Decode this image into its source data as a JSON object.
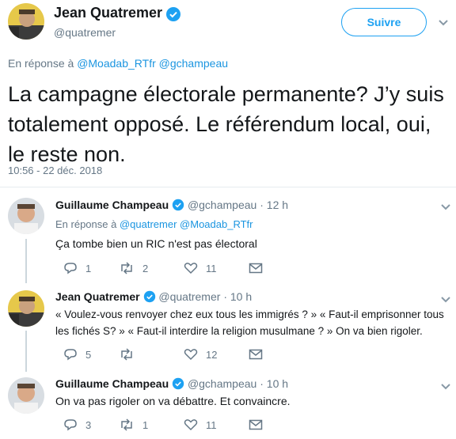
{
  "main_tweet": {
    "author_name": "Jean Quatremer",
    "handle": "@quatremer",
    "follow_label": "Suivre",
    "reply_prefix": "En réponse à",
    "reply_to_1": "@Moadab_RTfr",
    "reply_to_2": "@gchampeau",
    "text_line1": "La campagne électorale permanente? J’y suis",
    "text_line2": "totalement opposé. Le référendum local, oui,",
    "text_line3": "le reste non.",
    "timestamp": "10:56 - 22 déc. 2018"
  },
  "replies": [
    {
      "author_name": "Guillaume Champeau",
      "handle": "@gchampeau",
      "time": "12 h",
      "reply_prefix": "En réponse à",
      "reply_to_1": "@quatremer",
      "reply_to_2": "@Moadab_RTfr",
      "text": "Ça tombe bien un RIC n'est pas électoral",
      "reply_count": "1",
      "retweet_count": "2",
      "like_count": "11"
    },
    {
      "author_name": "Jean Quatremer",
      "handle": "@quatremer",
      "time": "10 h",
      "text_line1": "« Voulez-vous renvoyer chez eux tous les immigrés ? » « Faut-il emprisonner tous",
      "text_line2": "les fichés S? » « Faut-il interdire la religion musulmane ? » On va bien rigoler.",
      "reply_count": "5",
      "retweet_count": "",
      "like_count": "12"
    },
    {
      "author_name": "Guillaume Champeau",
      "handle": "@gchampeau",
      "time": "10 h",
      "text": "On va pas rigoler on va débattre. Et convaincre.",
      "reply_count": "3",
      "retweet_count": "1",
      "like_count": "11"
    }
  ],
  "dot": "·",
  "colors": {
    "accent": "#1da1f2",
    "link": "#1b95e0",
    "muted": "#657786",
    "text": "#14171a",
    "separator": "#e6ecf0"
  },
  "icons": [
    "verified-icon",
    "chevron-down-icon",
    "reply-icon",
    "retweet-icon",
    "like-icon",
    "dm-icon"
  ]
}
